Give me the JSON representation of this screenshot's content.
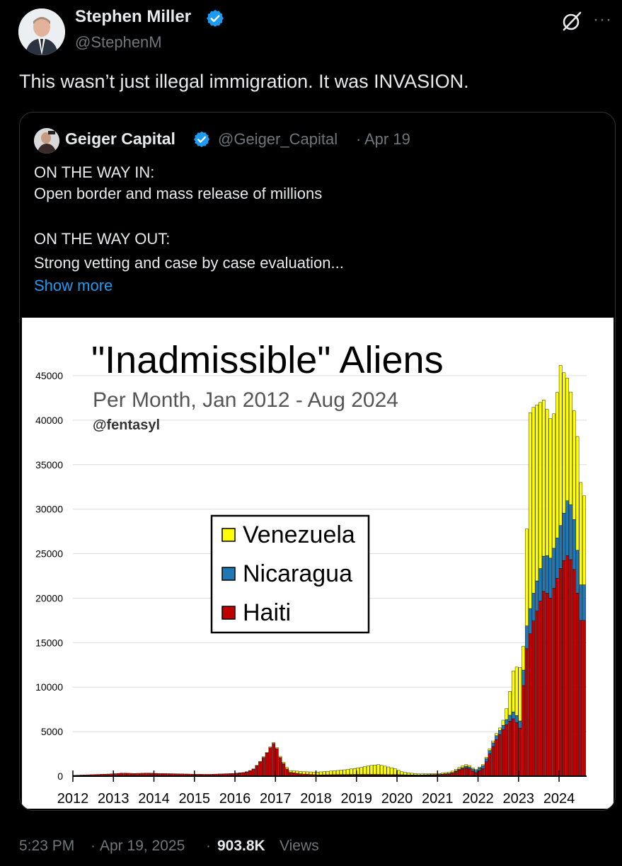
{
  "author": {
    "name": "Stephen Miller",
    "handle": "@StephenM",
    "verified": true,
    "avatar_icon": "person-avatar"
  },
  "tweet": {
    "text": "This wasn’t just illegal immigration. It was INVASION."
  },
  "header_icons": {
    "grok": "grok-icon",
    "more": "···"
  },
  "quote": {
    "name": "Geiger Capital",
    "handle": "@Geiger_Capital",
    "separator": "·",
    "date": "Apr 19",
    "lines": [
      "ON THE WAY IN:",
      "Open border and mass release of millions",
      "",
      "ON THE WAY OUT:",
      "Strong vetting and case by case evaluation..."
    ],
    "show_more": "Show more"
  },
  "chart_data": {
    "type": "bar",
    "stacked": true,
    "title": "\"Inadmissible\" Aliens",
    "subtitle": "Per Month, Jan 2012 - Aug 2024",
    "credit": "@fentasyl",
    "ylim": [
      0,
      45000
    ],
    "yticks": [
      0,
      5000,
      10000,
      15000,
      20000,
      25000,
      30000,
      35000,
      40000,
      45000
    ],
    "xticks": [
      "2012",
      "2013",
      "2014",
      "2015",
      "2016",
      "2017",
      "2018",
      "2019",
      "2020",
      "2021",
      "2022",
      "2023",
      "2024"
    ],
    "legend_position": "center-left",
    "colors": {
      "Haiti": "#c00000",
      "Nicaragua": "#1f77b4",
      "Venezuela": "#ffff00"
    },
    "series": [
      {
        "name": "Haiti",
        "values": [
          [
            2012,
            100
          ],
          [
            2012.3,
            150
          ],
          [
            2012.6,
            200
          ],
          [
            2012.9,
            250
          ],
          [
            2013.2,
            350
          ],
          [
            2013.5,
            300
          ],
          [
            2013.8,
            350
          ],
          [
            2014.1,
            300
          ],
          [
            2014.4,
            280
          ],
          [
            2014.7,
            250
          ],
          [
            2015.0,
            220
          ],
          [
            2015.3,
            200
          ],
          [
            2015.6,
            250
          ],
          [
            2015.9,
            300
          ],
          [
            2016.2,
            400
          ],
          [
            2016.4,
            700
          ],
          [
            2016.55,
            1400
          ],
          [
            2016.7,
            2300
          ],
          [
            2016.8,
            2900
          ],
          [
            2016.9,
            3800
          ],
          [
            2017.0,
            3100
          ],
          [
            2017.1,
            1900
          ],
          [
            2017.3,
            450
          ],
          [
            2017.6,
            250
          ],
          [
            2018.0,
            150
          ],
          [
            2018.5,
            150
          ],
          [
            2019.0,
            150
          ],
          [
            2019.5,
            150
          ],
          [
            2020.0,
            120
          ],
          [
            2020.5,
            80
          ],
          [
            2021.0,
            150
          ],
          [
            2021.3,
            250
          ],
          [
            2021.5,
            700
          ],
          [
            2021.7,
            1000
          ],
          [
            2021.9,
            350
          ],
          [
            2022.1,
            900
          ],
          [
            2022.25,
            2500
          ],
          [
            2022.4,
            4000
          ],
          [
            2022.55,
            5000
          ],
          [
            2022.7,
            6000
          ],
          [
            2022.85,
            6500
          ],
          [
            2023.0,
            5400
          ],
          [
            2023.15,
            14000
          ],
          [
            2023.3,
            17000
          ],
          [
            2023.45,
            19000
          ],
          [
            2023.6,
            21000
          ],
          [
            2023.75,
            20000
          ],
          [
            2023.9,
            22000
          ],
          [
            2024.05,
            24000
          ],
          [
            2024.2,
            25000
          ],
          [
            2024.35,
            23000
          ],
          [
            2024.5,
            17500
          ]
        ]
      },
      {
        "name": "Nicaragua",
        "values": [
          [
            2012,
            0
          ],
          [
            2012.5,
            0
          ],
          [
            2013,
            0
          ],
          [
            2014,
            0
          ],
          [
            2015,
            0
          ],
          [
            2016,
            0
          ],
          [
            2017,
            0
          ],
          [
            2018,
            0
          ],
          [
            2019,
            50
          ],
          [
            2020,
            50
          ],
          [
            2021,
            50
          ],
          [
            2021.5,
            100
          ],
          [
            2022,
            300
          ],
          [
            2022.3,
            400
          ],
          [
            2022.6,
            500
          ],
          [
            2022.85,
            800
          ],
          [
            2023.0,
            800
          ],
          [
            2023.15,
            2500
          ],
          [
            2023.3,
            3000
          ],
          [
            2023.45,
            3500
          ],
          [
            2023.6,
            4000
          ],
          [
            2023.75,
            4500
          ],
          [
            2023.9,
            4500
          ],
          [
            2024.05,
            5000
          ],
          [
            2024.2,
            6500
          ],
          [
            2024.35,
            5500
          ],
          [
            2024.5,
            4000
          ]
        ]
      },
      {
        "name": "Venezuela",
        "values": [
          [
            2012,
            0
          ],
          [
            2013,
            0
          ],
          [
            2014,
            0
          ],
          [
            2015,
            0
          ],
          [
            2016,
            0
          ],
          [
            2017,
            100
          ],
          [
            2017.5,
            250
          ],
          [
            2018,
            300
          ],
          [
            2018.3,
            400
          ],
          [
            2018.6,
            500
          ],
          [
            2018.9,
            650
          ],
          [
            2019.1,
            800
          ],
          [
            2019.3,
            1000
          ],
          [
            2019.5,
            1100
          ],
          [
            2019.7,
            900
          ],
          [
            2019.9,
            700
          ],
          [
            2020.1,
            300
          ],
          [
            2020.4,
            150
          ],
          [
            2020.8,
            100
          ],
          [
            2021.0,
            100
          ],
          [
            2021.3,
            150
          ],
          [
            2021.6,
            200
          ],
          [
            2022.0,
            100
          ],
          [
            2022.3,
            200
          ],
          [
            2022.55,
            300
          ],
          [
            2022.7,
            1500
          ],
          [
            2022.85,
            5000
          ],
          [
            2023.0,
            6000
          ],
          [
            2023.1,
            2000
          ],
          [
            2023.25,
            22000
          ],
          [
            2023.4,
            20000
          ],
          [
            2023.55,
            18000
          ],
          [
            2023.7,
            16000
          ],
          [
            2023.85,
            15000
          ],
          [
            2024.0,
            18000
          ],
          [
            2024.15,
            14000
          ],
          [
            2024.3,
            12000
          ],
          [
            2024.45,
            13000
          ],
          [
            2024.55,
            10000
          ]
        ]
      }
    ]
  },
  "footer": {
    "time": "5:23 PM",
    "dot1": "·",
    "date": "Apr 19, 2025",
    "dot2": "·",
    "views_count": "903.8K",
    "views_label": "Views"
  }
}
